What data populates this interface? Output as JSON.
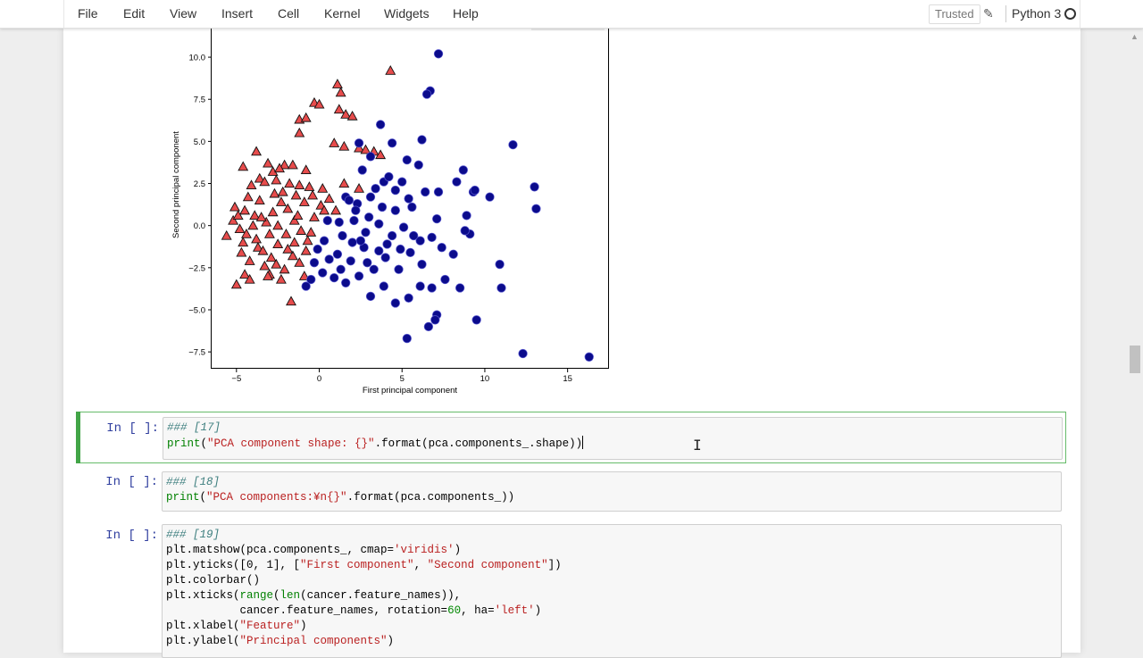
{
  "menubar": {
    "items": [
      "File",
      "Edit",
      "View",
      "Insert",
      "Cell",
      "Kernel",
      "Widgets",
      "Help"
    ],
    "trusted_label": "Trusted",
    "kernel_name": "Python 3"
  },
  "chart_data": {
    "type": "scatter",
    "xlabel": "First principal component",
    "ylabel": "Second principal component",
    "xlim": [
      -6.5,
      17.5
    ],
    "ylim": [
      -8.5,
      11.7
    ],
    "xticks": [
      -5,
      0,
      5,
      10,
      15
    ],
    "xtick_labels": [
      "−5",
      "0",
      "5",
      "10",
      "15"
    ],
    "yticks": [
      -7.5,
      -5.0,
      -2.5,
      0.0,
      2.5,
      5.0,
      7.5,
      10.0
    ],
    "ytick_labels": [
      "−7.5",
      "−5.0",
      "−2.5",
      "0.0",
      "2.5",
      "5.0",
      "7.5",
      "10.0"
    ],
    "series": [
      {
        "marker": "triangle",
        "color": "#e74c4c",
        "points": [
          [
            4.3,
            9.2
          ],
          [
            1.1,
            8.4
          ],
          [
            1.3,
            7.9
          ],
          [
            -0.3,
            7.3
          ],
          [
            0.0,
            7.2
          ],
          [
            1.2,
            6.9
          ],
          [
            1.6,
            6.6
          ],
          [
            2.0,
            6.5
          ],
          [
            -1.2,
            6.3
          ],
          [
            -0.8,
            6.4
          ],
          [
            -1.2,
            5.5
          ],
          [
            0.9,
            4.9
          ],
          [
            1.5,
            4.7
          ],
          [
            2.4,
            4.6
          ],
          [
            2.8,
            4.5
          ],
          [
            3.3,
            4.4
          ],
          [
            3.7,
            4.2
          ],
          [
            -3.8,
            4.4
          ],
          [
            -4.6,
            3.5
          ],
          [
            -3.1,
            3.7
          ],
          [
            -2.1,
            3.6
          ],
          [
            -1.6,
            3.6
          ],
          [
            -0.8,
            3.3
          ],
          [
            -2.8,
            3.2
          ],
          [
            -2.4,
            3.4
          ],
          [
            -3.6,
            2.8
          ],
          [
            -4.1,
            2.4
          ],
          [
            -3.3,
            2.6
          ],
          [
            -2.6,
            2.7
          ],
          [
            -1.8,
            2.5
          ],
          [
            -1.2,
            2.4
          ],
          [
            -0.6,
            2.3
          ],
          [
            0.2,
            2.2
          ],
          [
            1.5,
            2.5
          ],
          [
            2.4,
            2.2
          ],
          [
            -5.1,
            1.1
          ],
          [
            -4.5,
            0.9
          ],
          [
            -3.9,
            0.6
          ],
          [
            -5.6,
            -0.6
          ],
          [
            -5.2,
            0.3
          ],
          [
            -4.8,
            -0.2
          ],
          [
            -4.4,
            -0.5
          ],
          [
            -3.8,
            -0.8
          ],
          [
            -3.2,
            0.2
          ],
          [
            -2.8,
            0.8
          ],
          [
            -2.3,
            1.4
          ],
          [
            -1.9,
            1.0
          ],
          [
            -1.5,
            0.3
          ],
          [
            -1.1,
            -0.3
          ],
          [
            -0.7,
            -0.9
          ],
          [
            -0.3,
            0.5
          ],
          [
            0.1,
            1.2
          ],
          [
            0.6,
            1.6
          ],
          [
            1.0,
            0.9
          ],
          [
            -4.7,
            -1.6
          ],
          [
            -4.2,
            -2.1
          ],
          [
            -3.7,
            -1.3
          ],
          [
            -3.3,
            -2.4
          ],
          [
            -2.9,
            -1.9
          ],
          [
            -2.5,
            -1.1
          ],
          [
            -2.1,
            -2.6
          ],
          [
            -1.6,
            -1.8
          ],
          [
            -1.2,
            -2.2
          ],
          [
            -0.8,
            -1.5
          ],
          [
            -4.5,
            -2.9
          ],
          [
            -5.0,
            -3.5
          ],
          [
            -4.2,
            -3.2
          ],
          [
            -3.0,
            -2.9
          ],
          [
            -1.7,
            -4.5
          ],
          [
            -0.9,
            -3.0
          ],
          [
            -4.0,
            0.0
          ],
          [
            -3.5,
            0.5
          ],
          [
            -3.0,
            -0.5
          ],
          [
            -2.5,
            0.0
          ],
          [
            -2.0,
            -0.5
          ],
          [
            -1.5,
            -1.0
          ],
          [
            -3.6,
            1.5
          ],
          [
            -2.7,
            1.9
          ],
          [
            -2.2,
            2.0
          ],
          [
            -1.4,
            1.8
          ],
          [
            -0.9,
            1.4
          ],
          [
            -0.4,
            1.8
          ],
          [
            -4.9,
            0.6
          ],
          [
            -4.3,
            1.7
          ],
          [
            -3.1,
            -3.0
          ],
          [
            -2.3,
            -3.2
          ],
          [
            -4.6,
            -1.0
          ],
          [
            -3.4,
            -1.5
          ],
          [
            -2.6,
            -2.3
          ],
          [
            -1.9,
            -1.4
          ],
          [
            -1.3,
            0.6
          ],
          [
            -0.5,
            -0.4
          ],
          [
            0.3,
            0.9
          ]
        ]
      },
      {
        "marker": "circle",
        "color": "#0b0b8c",
        "points": [
          [
            7.2,
            10.2
          ],
          [
            6.7,
            8.0
          ],
          [
            6.5,
            7.8
          ],
          [
            3.7,
            6.0
          ],
          [
            6.2,
            5.1
          ],
          [
            11.7,
            4.8
          ],
          [
            2.4,
            4.9
          ],
          [
            4.4,
            4.9
          ],
          [
            3.1,
            4.1
          ],
          [
            5.3,
            3.9
          ],
          [
            6.0,
            3.6
          ],
          [
            8.7,
            3.3
          ],
          [
            8.3,
            2.6
          ],
          [
            9.3,
            2.0
          ],
          [
            10.3,
            1.7
          ],
          [
            13.0,
            2.3
          ],
          [
            13.1,
            1.0
          ],
          [
            2.6,
            3.3
          ],
          [
            3.9,
            2.6
          ],
          [
            4.6,
            2.1
          ],
          [
            5.4,
            1.6
          ],
          [
            6.4,
            2.0
          ],
          [
            7.2,
            2.0
          ],
          [
            9.4,
            2.1
          ],
          [
            1.6,
            1.7
          ],
          [
            2.3,
            1.3
          ],
          [
            3.1,
            1.7
          ],
          [
            3.8,
            1.1
          ],
          [
            4.6,
            0.9
          ],
          [
            5.6,
            1.1
          ],
          [
            7.1,
            0.4
          ],
          [
            8.9,
            0.6
          ],
          [
            9.1,
            -0.5
          ],
          [
            8.8,
            -0.3
          ],
          [
            1.2,
            0.2
          ],
          [
            2.1,
            0.3
          ],
          [
            2.8,
            -0.4
          ],
          [
            3.6,
            0.1
          ],
          [
            4.4,
            -0.6
          ],
          [
            5.1,
            -0.1
          ],
          [
            6.1,
            -0.9
          ],
          [
            6.8,
            -0.7
          ],
          [
            7.4,
            -1.3
          ],
          [
            8.1,
            -1.7
          ],
          [
            10.9,
            -2.3
          ],
          [
            0.3,
            -0.9
          ],
          [
            1.1,
            -1.7
          ],
          [
            1.9,
            -2.1
          ],
          [
            2.7,
            -1.3
          ],
          [
            3.3,
            -2.6
          ],
          [
            4.0,
            -1.9
          ],
          [
            4.8,
            -2.6
          ],
          [
            5.5,
            -1.6
          ],
          [
            6.2,
            -2.3
          ],
          [
            0.9,
            -3.1
          ],
          [
            1.6,
            -3.4
          ],
          [
            2.4,
            -3.0
          ],
          [
            3.1,
            -4.2
          ],
          [
            3.9,
            -3.6
          ],
          [
            4.6,
            -4.6
          ],
          [
            5.4,
            -4.3
          ],
          [
            6.1,
            -3.6
          ],
          [
            6.8,
            -3.7
          ],
          [
            7.6,
            -3.2
          ],
          [
            8.5,
            -3.7
          ],
          [
            11.0,
            -3.7
          ],
          [
            7.1,
            -5.3
          ],
          [
            7.0,
            -5.6
          ],
          [
            6.6,
            -6.0
          ],
          [
            9.5,
            -5.6
          ],
          [
            5.3,
            -6.7
          ],
          [
            12.3,
            -7.6
          ],
          [
            16.3,
            -7.8
          ],
          [
            -0.8,
            -3.6
          ],
          [
            -0.3,
            -2.2
          ],
          [
            0.2,
            -2.8
          ],
          [
            1.4,
            -0.6
          ],
          [
            2.2,
            0.9
          ],
          [
            3.0,
            0.5
          ],
          [
            4.1,
            -1.1
          ],
          [
            4.9,
            -1.4
          ],
          [
            5.7,
            -0.6
          ],
          [
            0.5,
            0.3
          ],
          [
            -0.1,
            -1.4
          ],
          [
            1.8,
            1.5
          ],
          [
            2.5,
            -0.9
          ],
          [
            3.4,
            2.2
          ],
          [
            4.2,
            2.9
          ],
          [
            5.0,
            2.6
          ],
          [
            3.6,
            -1.5
          ],
          [
            2.9,
            -2.2
          ],
          [
            1.3,
            -2.6
          ],
          [
            0.6,
            -2.0
          ],
          [
            2.0,
            -1.0
          ],
          [
            -0.5,
            -3.2
          ]
        ]
      }
    ]
  },
  "cells": [
    {
      "prompt": "In [ ]:",
      "lines": [
        [
          [
            "c",
            "### [17]"
          ]
        ],
        [
          [
            "b",
            "print"
          ],
          [
            "p",
            "("
          ],
          [
            "s",
            "\"PCA component shape: {}\""
          ],
          [
            "p",
            ".format(pca.components_.shape))"
          ]
        ]
      ]
    },
    {
      "prompt": "In [ ]:",
      "lines": [
        [
          [
            "c",
            "### [18]"
          ]
        ],
        [
          [
            "b",
            "print"
          ],
          [
            "p",
            "("
          ],
          [
            "s",
            "\"PCA components:¥n{}\""
          ],
          [
            "p",
            ".format(pca.components_))"
          ]
        ]
      ]
    },
    {
      "prompt": "In [ ]:",
      "lines": [
        [
          [
            "c",
            "### [19]"
          ]
        ],
        [
          [
            "p",
            "plt.matshow(pca.components_, cmap="
          ],
          [
            "s",
            "'viridis'"
          ],
          [
            "p",
            ")"
          ]
        ],
        [
          [
            "p",
            "plt.yticks([0, 1], ["
          ],
          [
            "s",
            "\"First component\""
          ],
          [
            "p",
            ", "
          ],
          [
            "s",
            "\"Second component\""
          ],
          [
            "p",
            "])"
          ]
        ],
        [
          [
            "p",
            "plt.colorbar()"
          ]
        ],
        [
          [
            "p",
            "plt.xticks("
          ],
          [
            "b",
            "range"
          ],
          [
            "p",
            "("
          ],
          [
            "b",
            "len"
          ],
          [
            "p",
            "(cancer.feature_names)),"
          ]
        ],
        [
          [
            "p",
            "           cancer.feature_names, rotation="
          ],
          [
            "n",
            "60"
          ],
          [
            "p",
            ", ha="
          ],
          [
            "s",
            "'left'"
          ],
          [
            "p",
            ")"
          ]
        ],
        [
          [
            "p",
            "plt.xlabel("
          ],
          [
            "s",
            "\"Feature\""
          ],
          [
            "p",
            ")"
          ]
        ],
        [
          [
            "p",
            "plt.ylabel("
          ],
          [
            "s",
            "\"Principal components\""
          ],
          [
            "p",
            ")"
          ]
        ]
      ]
    }
  ]
}
